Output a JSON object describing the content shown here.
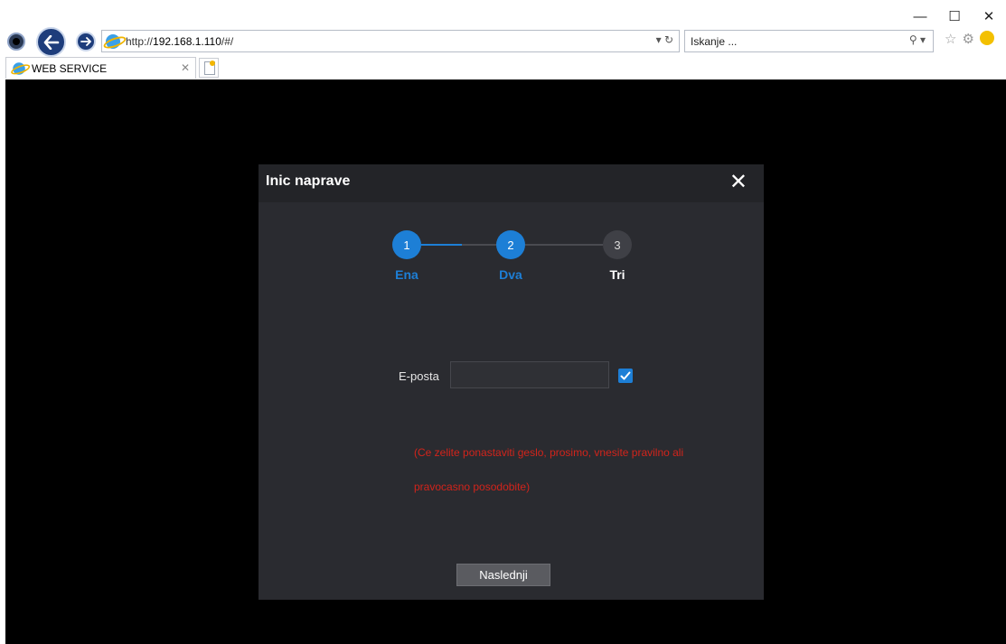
{
  "browser": {
    "url_prefix": "http://",
    "url_host": "192.168.1.110",
    "url_suffix": "/#/",
    "search_placeholder": "Iskanje ...",
    "tab_title": "WEB SERVICE"
  },
  "modal": {
    "title": "Inic naprave",
    "steps": [
      {
        "number": "1",
        "label": "Ena",
        "active": true
      },
      {
        "number": "2",
        "label": "Dva",
        "active": true
      },
      {
        "number": "3",
        "label": "Tri",
        "active": false
      }
    ],
    "email_label": "E-posta",
    "email_value": "",
    "email_checked": true,
    "hint_line1": "(Ce zelite ponastaviti geslo, prosimo, vnesite pravilno ali",
    "hint_line2": "pravocasno posodobite)",
    "next_label": "Naslednji"
  },
  "colors": {
    "accent": "#1d7fd6",
    "error": "#d2241b",
    "modal_bg": "#2a2b30",
    "page_bg": "#000000"
  }
}
